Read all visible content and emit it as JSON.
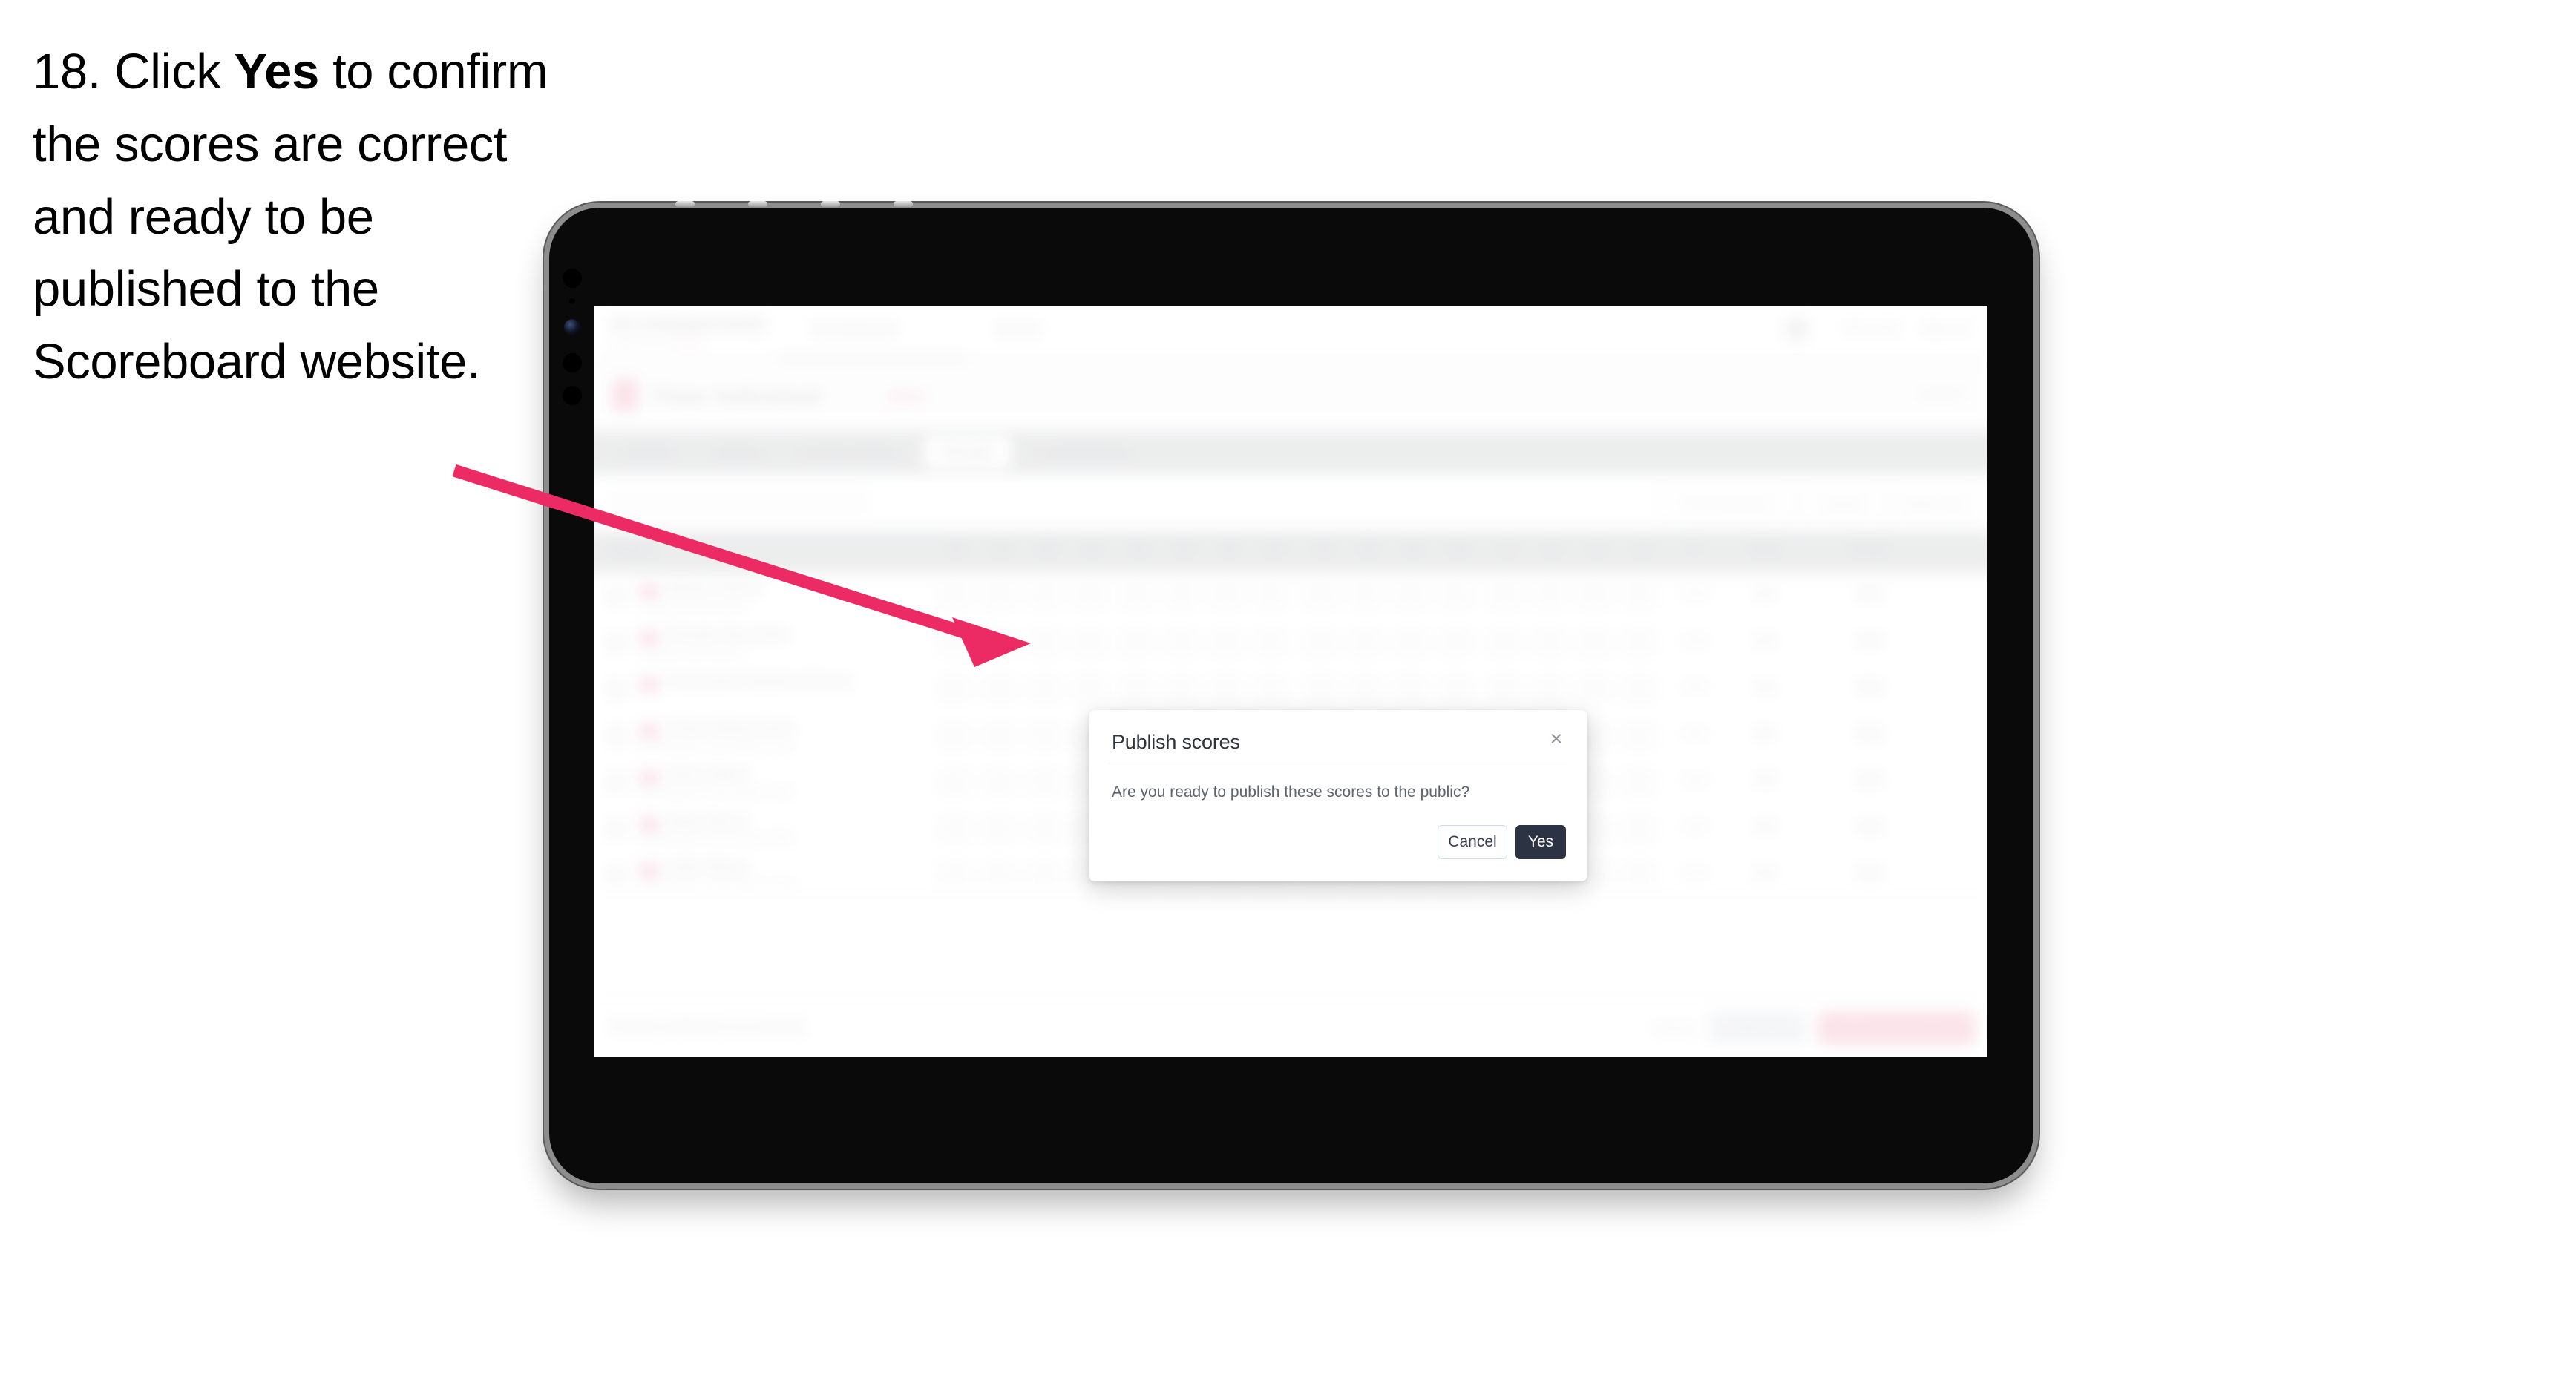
{
  "instruction": {
    "number": "18.",
    "pre": "Click ",
    "bold": "Yes",
    "post": " to confirm the scores are correct and ready to be published to the Scoreboard website."
  },
  "colors": {
    "arrow": "#ec2a63",
    "dialog_primary": "#2c3443",
    "brand_pink": "#f2418a",
    "device_frame": "#8d8d8d",
    "device_body": "#0a0a0a"
  },
  "device": {
    "name": "tablet-device",
    "bezel_label": "tablet-bezel",
    "screen_label": "tablet-screen"
  },
  "dialog": {
    "title": "Publish scores",
    "close_icon": "×",
    "body": "Are you ready to publish these scores to the public?",
    "cancel_label": "Cancel",
    "confirm_label": "Yes"
  },
  "app": {
    "logo": "SCOREBOARD",
    "logo_sub_left": "powered by",
    "logo_sub_brand": "SGB",
    "nav": [
      {
        "label": "Scoreboard"
      },
      {
        "label": "Event"
      }
    ],
    "header_right": [
      {
        "label": "Tom Lane"
      },
      {
        "label": "Sign out"
      }
    ],
    "competition_title": "Floor Individual",
    "competition_year": "2024",
    "competition_right": "Level 3",
    "tabs": [
      {
        "label": "Details"
      },
      {
        "label": "Teams"
      },
      {
        "label": "Control Sheet"
      },
      {
        "label": "Results"
      },
      {
        "label": "Leaderboard"
      }
    ],
    "active_tab": "Results",
    "search_placeholder": "Search",
    "filter_chips": [
      {
        "label": "Print Scorecard"
      },
      {
        "label": "Reload"
      },
      {
        "label": "Table Only"
      }
    ],
    "table": {
      "columns": [
        "Player",
        "D1",
        "D2",
        "D3",
        "D4",
        "A1",
        "A2",
        "A3",
        "A4",
        "E1",
        "E2",
        "E3",
        "E4",
        "L1",
        "L2",
        "L3",
        "L4",
        "P",
        "Total",
        "Detail"
      ],
      "rows": [
        {
          "flag": "GBR",
          "name": "Maisie Tanner",
          "club": "Liverpool Gymnastics",
          "d": [
            "0",
            "0",
            "0",
            "0"
          ],
          "a": [
            "0",
            "0",
            "0",
            "0"
          ],
          "e": [
            "0",
            "0",
            "0",
            "0"
          ],
          "l": [
            "0",
            "0",
            "0",
            "0"
          ],
          "p": "0.00",
          "total": "0.0",
          "detail": "Edit"
        },
        {
          "flag": "GBR",
          "name": "Phoebe Reynolds",
          "club": "Anwood Gymnastics",
          "d": [
            "0",
            "0",
            "0",
            "0"
          ],
          "a": [
            "0",
            "0",
            "0",
            "0"
          ],
          "e": [
            "0",
            "0",
            "0",
            "0"
          ],
          "l": [
            "0",
            "0",
            "0",
            "0"
          ],
          "p": "0.00",
          "total": "0.0",
          "detail": "Edit"
        },
        {
          "flag": "GBR",
          "name": "Cassandra Hawkins-Devon",
          "club": "",
          "d": [
            "0",
            "0",
            "0",
            "0"
          ],
          "a": [
            "0",
            "0",
            "0",
            "0"
          ],
          "e": [
            "0",
            "0",
            "0",
            "0"
          ],
          "l": [
            "0",
            "0",
            "0",
            "0"
          ],
          "p": "0.00",
          "total": "0.0",
          "detail": "Edit"
        },
        {
          "flag": "GBR",
          "name": "Chloe Abbey-Hunt",
          "club": "Northampton Gymnastics Club",
          "d": [
            "0",
            "0",
            "0",
            "0"
          ],
          "a": [
            "0",
            "0",
            "0",
            "0"
          ],
          "e": [
            "0",
            "0",
            "0",
            "0"
          ],
          "l": [
            "0",
            "0",
            "0",
            "0"
          ],
          "p": "0.00",
          "total": "0.0",
          "detail": "Edit"
        },
        {
          "flag": "GBR",
          "name": "Olivia Ward",
          "club": "Northampton Gymnastics Club",
          "d": [
            "0",
            "0",
            "0",
            "0"
          ],
          "a": [
            "0",
            "0",
            "0",
            "0"
          ],
          "e": [
            "0",
            "0",
            "0",
            "0"
          ],
          "l": [
            "0",
            "0",
            "0",
            "0"
          ],
          "p": "0.00",
          "total": "0.0",
          "detail": "Edit"
        },
        {
          "flag": "GBR",
          "name": "Maya Binns",
          "club": "Northampton Gymnastics Club",
          "d": [
            "0",
            "0",
            "0",
            "0"
          ],
          "a": [
            "0",
            "0",
            "0",
            "0"
          ],
          "e": [
            "0",
            "0",
            "0",
            "0"
          ],
          "l": [
            "0",
            "0",
            "0",
            "0"
          ],
          "p": "0.00",
          "total": "0.0",
          "detail": "Edit"
        },
        {
          "flag": "GBR",
          "name": "Halle Bailey",
          "club": "Northampton Gymnastics Club",
          "d": [
            "0",
            "0",
            "0",
            "0"
          ],
          "a": [
            "0",
            "0",
            "0",
            "0"
          ],
          "e": [
            "0",
            "0",
            "0",
            "0"
          ],
          "l": [
            "0",
            "0",
            "0",
            "0"
          ],
          "p": "0.00",
          "total": "0.0",
          "detail": "Edit"
        }
      ]
    },
    "footer": {
      "note": "Results published successfully",
      "link": "Cancel",
      "secondary_button": "Save All",
      "primary_button": "Publish to Scoreboard"
    }
  }
}
